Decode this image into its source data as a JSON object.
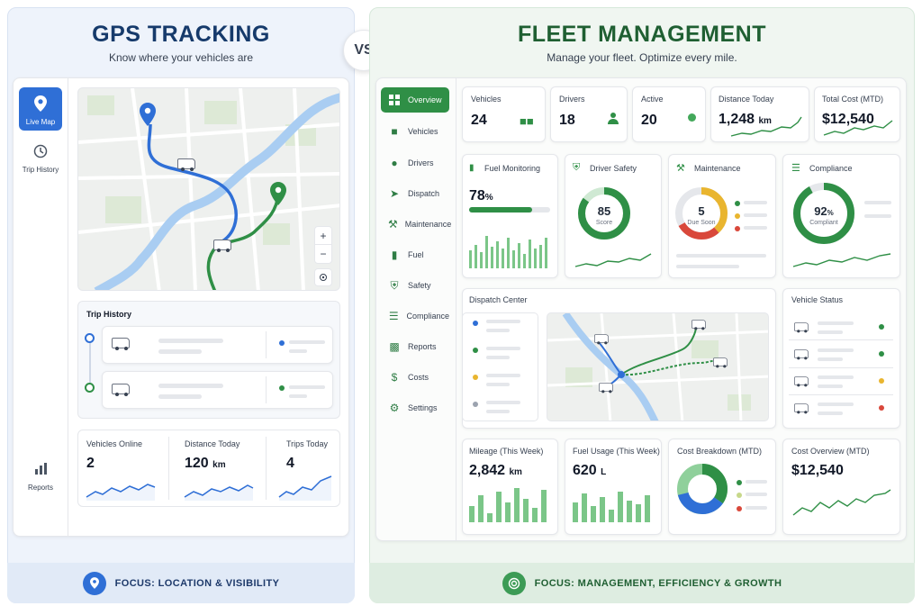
{
  "left": {
    "title": "GPS TRACKING",
    "subtitle": "Know where your vehicles are",
    "sidebar": {
      "live_map": "Live Map",
      "trip_history": "Trip History",
      "reports": "Reports"
    },
    "trip_history_title": "Trip History",
    "stats": [
      {
        "label": "Vehicles Online",
        "value": "2",
        "unit": ""
      },
      {
        "label": "Distance Today",
        "value": "120",
        "unit": "km"
      },
      {
        "label": "Trips Today",
        "value": "4",
        "unit": ""
      }
    ],
    "zoom_in": "+",
    "zoom_out": "−",
    "footer": "FOCUS: LOCATION & VISIBILITY"
  },
  "vs": "VS",
  "right": {
    "title": "FLEET MANAGEMENT",
    "subtitle": "Manage your fleet. Optimize every mile.",
    "nav": [
      "Overview",
      "Vehicles",
      "Drivers",
      "Dispatch",
      "Maintenance",
      "Fuel",
      "Safety",
      "Compliance",
      "Reports",
      "Costs",
      "Settings"
    ],
    "kpis": [
      {
        "label": "Vehicles",
        "value": "24"
      },
      {
        "label": "Drivers",
        "value": "18"
      },
      {
        "label": "Active",
        "value": "20"
      },
      {
        "label": "Distance Today",
        "value": "1,248",
        "unit": "km"
      },
      {
        "label": "Total Cost (MTD)",
        "value": "$12,540"
      }
    ],
    "fuel_monitoring": {
      "label": "Fuel Monitoring",
      "value": "78",
      "unit": "%",
      "progress": 0.78
    },
    "driver_safety": {
      "label": "Driver Safety",
      "value": "85",
      "caption": "Score"
    },
    "maintenance": {
      "label": "Maintenance",
      "value": "5",
      "caption": "Due Soon"
    },
    "compliance": {
      "label": "Compliance",
      "value": "92",
      "unit": "%",
      "caption": "Compliant"
    },
    "dispatch_title": "Dispatch Center",
    "vehicle_status_title": "Vehicle Status",
    "mileage": {
      "label": "Mileage (This Week)",
      "value": "2,842",
      "unit": "km"
    },
    "fuel_usage": {
      "label": "Fuel Usage (This Week)",
      "value": "620",
      "unit": "L"
    },
    "cost_breakdown": {
      "label": "Cost Breakdown (MTD)"
    },
    "cost_overview": {
      "label": "Cost Overview (MTD)",
      "value": "$12,540"
    },
    "footer": "FOCUS: MANAGEMENT, EFFICIENCY & GROWTH"
  },
  "colors": {
    "blue": "#2f6fd6",
    "green": "#2f8f46",
    "amber": "#e9b52f",
    "red": "#d9483b"
  }
}
